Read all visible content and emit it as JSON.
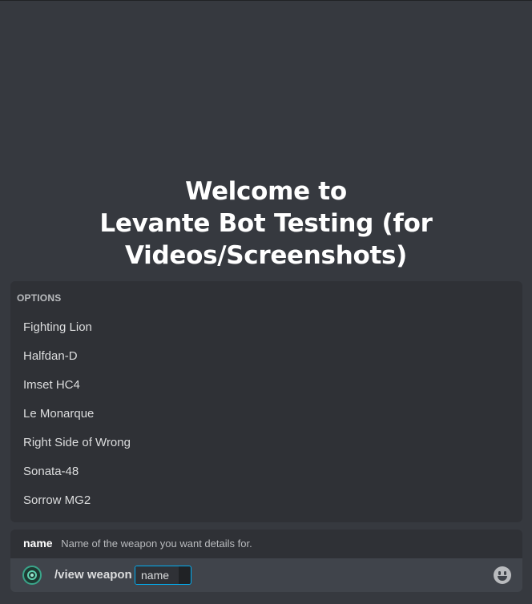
{
  "welcome": {
    "line1": "Welcome to",
    "line2": "Levante Bot Testing (for",
    "line3": "Videos/Screenshots)"
  },
  "options": {
    "header": "OPTIONS",
    "items": [
      {
        "label": "Fighting Lion"
      },
      {
        "label": "Halfdan-D"
      },
      {
        "label": "Imset HC4"
      },
      {
        "label": "Le Monarque"
      },
      {
        "label": "Right Side of Wrong"
      },
      {
        "label": "Sonata-48"
      },
      {
        "label": "Sorrow MG2"
      }
    ]
  },
  "param_hint": {
    "name": "name",
    "description": "Name of the weapon you want details for."
  },
  "input": {
    "command": "/view weapon",
    "param_label": "name",
    "bot_icon": "bot-avatar-icon",
    "emoji_icon": "emoji-smile-icon"
  },
  "colors": {
    "background": "#36393f",
    "panel": "#2f3136",
    "input": "#40444b",
    "accent": "#00aff4"
  }
}
